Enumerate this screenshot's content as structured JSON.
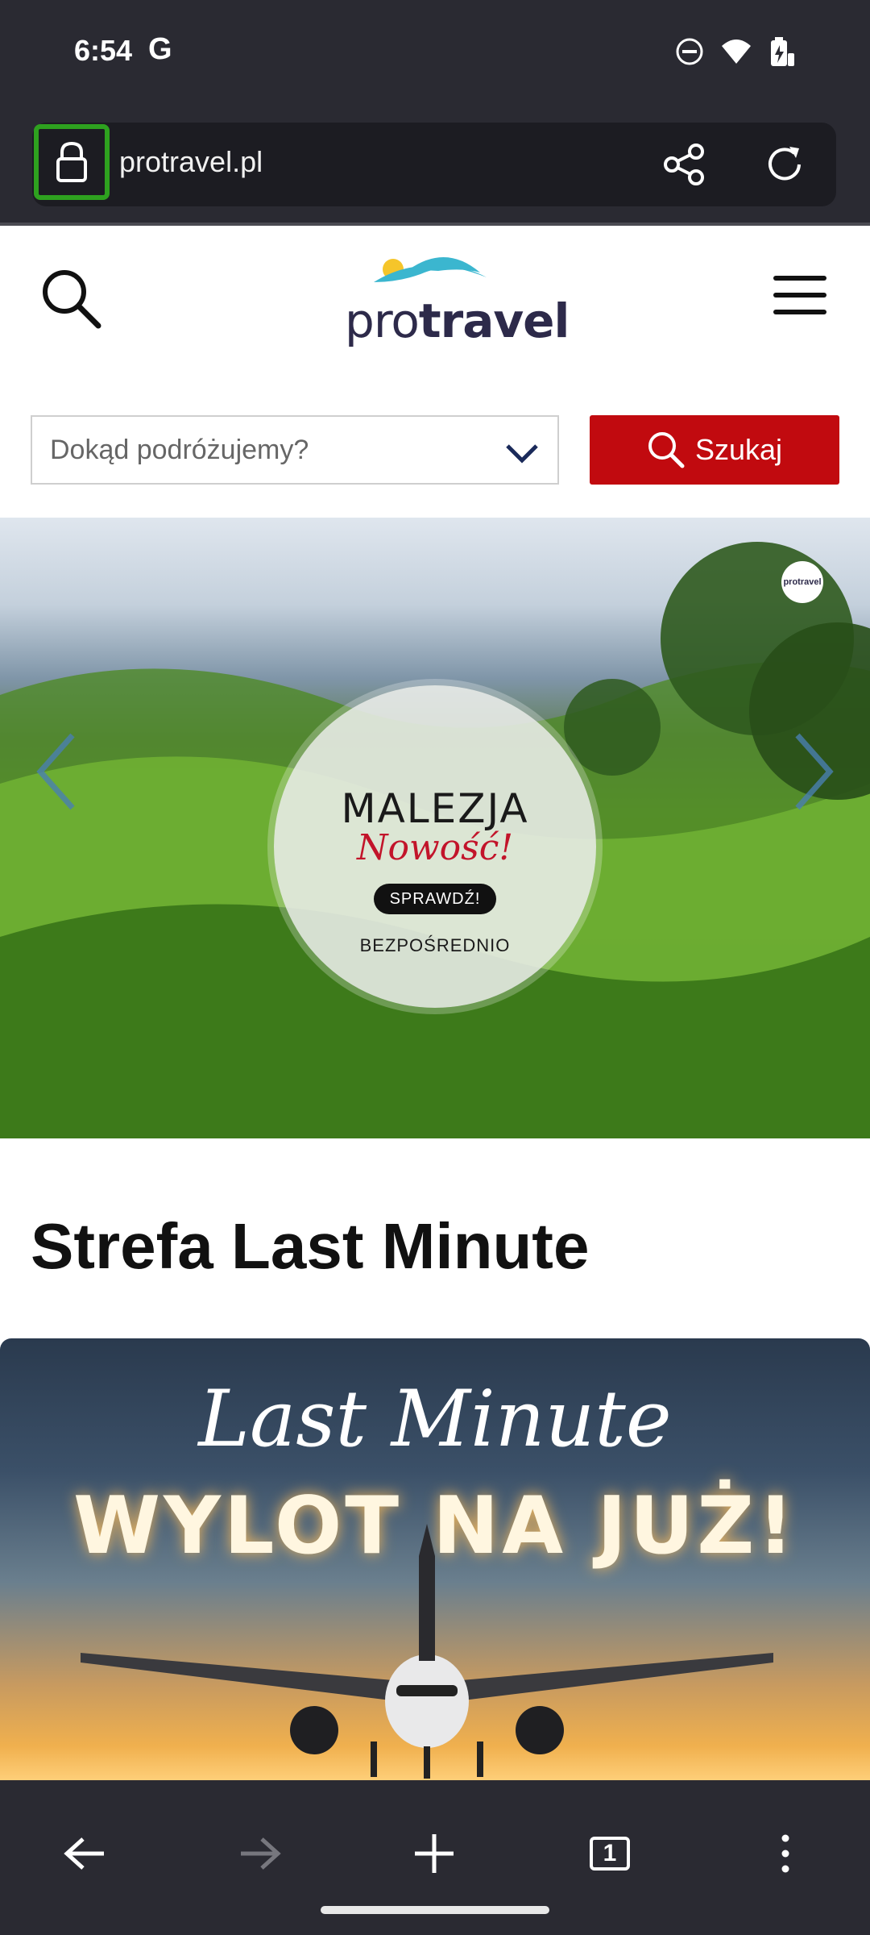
{
  "status_bar": {
    "time": "6:54",
    "google_glyph": "G",
    "icons": [
      "do-not-disturb-icon",
      "wifi-icon",
      "battery-charging-icon"
    ]
  },
  "browser": {
    "url": "protravel.pl",
    "tab_count": "1"
  },
  "site": {
    "logo_pro": "pro",
    "logo_travel": "travel",
    "search_placeholder": "Dokąd podróżujemy?",
    "search_button": "Szukaj",
    "brand_color": "#c10a0f"
  },
  "hero": {
    "title": "MALEZJA",
    "script": "Nowość!",
    "cta": "SPRAWDŹ!",
    "subtitle": "BEZPOŚREDNIO",
    "badge": "protravel"
  },
  "sections": {
    "last_minute_title": "Strefa Last Minute",
    "lm_script": "Last Minute",
    "lm_headline": "WYLOT NA JUŻ!"
  }
}
